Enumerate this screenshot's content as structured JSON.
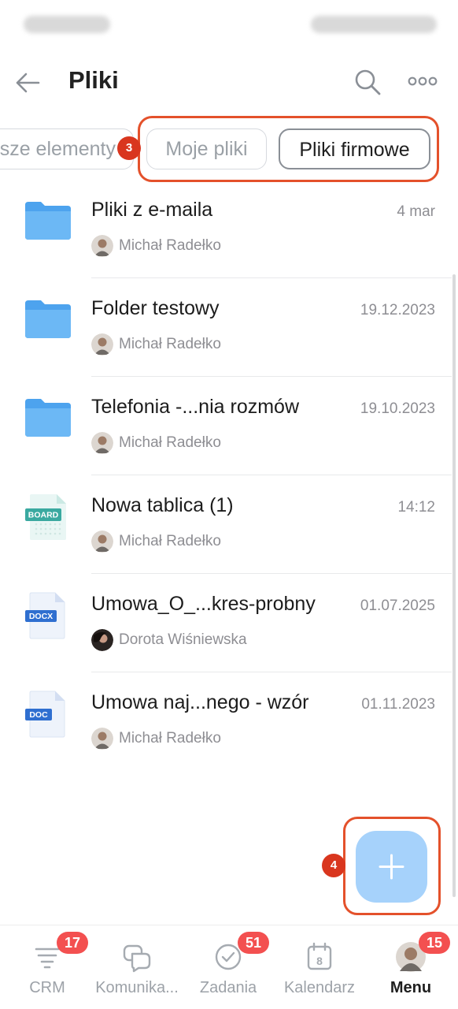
{
  "header": {
    "title": "Pliki",
    "back_icon": "arrow-left-icon",
    "search_icon": "search-icon",
    "more_icon": "more-horizontal-icon"
  },
  "filters": {
    "all_label": "Wszystkie elementy",
    "all_visible": "sze elementy",
    "mine_label": "Moje pliki",
    "company_label": "Pliki firmowe",
    "selected": "Pliki firmowe"
  },
  "annotations": {
    "filters_badge": "3",
    "fab_badge": "4",
    "color": "#e4512b"
  },
  "files": [
    {
      "name": "Pliki z e-maila",
      "date": "4 mar",
      "author": "Michał Radełko",
      "type": "folder"
    },
    {
      "name": "Folder testowy",
      "date": "19.12.2023",
      "author": "Michał Radełko",
      "type": "folder"
    },
    {
      "name": "Telefonia -...nia rozmów",
      "date": "19.10.2023",
      "author": "Michał Radełko",
      "type": "folder"
    },
    {
      "name": "Nowa tablica (1)",
      "date": "14:12",
      "author": "Michał Radełko",
      "type": "board",
      "badge": "BOARD"
    },
    {
      "name": "Umowa_O_...kres-probny",
      "date": "01.07.2025",
      "author": "Dorota Wiśniewska",
      "type": "docx",
      "badge": "DOCX"
    },
    {
      "name": "Umowa naj...nego - wzór",
      "date": "01.11.2023",
      "author": "Michał Radełko",
      "type": "doc",
      "badge": "DOC"
    }
  ],
  "fab": {
    "icon": "plus-icon"
  },
  "nav": [
    {
      "label": "CRM",
      "badge": "17",
      "icon": "crm-funnel-icon"
    },
    {
      "label": "Komunika...",
      "badge": "",
      "icon": "chat-bubbles-icon"
    },
    {
      "label": "Zadania",
      "badge": "51",
      "icon": "check-circle-icon"
    },
    {
      "label": "Kalendarz",
      "badge": "",
      "icon": "calendar-icon",
      "calendar_day": "8"
    },
    {
      "label": "Menu",
      "badge": "15",
      "icon": "avatar",
      "active": true
    }
  ],
  "colors": {
    "accent_fab": "#a6d2fb",
    "folder": "#5aabf0",
    "badge_red": "#f35050",
    "docx_blue": "#2f6fd0",
    "board_teal": "#3aa9a0"
  }
}
